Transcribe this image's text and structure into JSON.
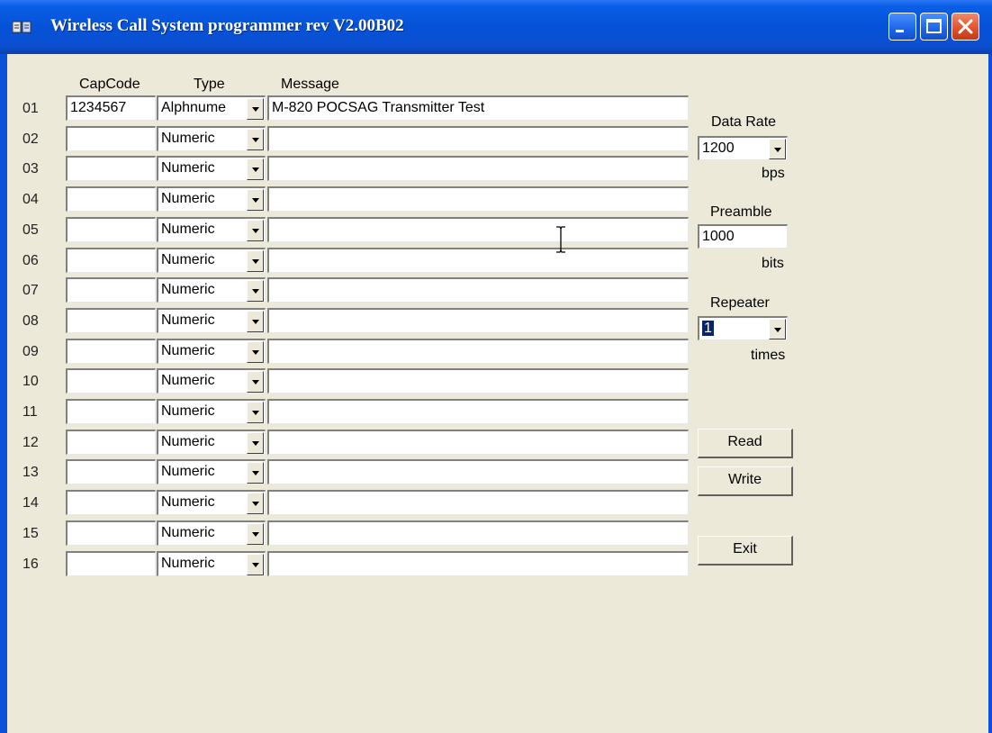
{
  "window": {
    "title": "Wireless Call System programmer rev  V2.00B02"
  },
  "headers": {
    "capcode": "CapCode",
    "type": "Type",
    "message": "Message"
  },
  "rows": [
    {
      "num": "01",
      "capcode": "1234567",
      "type": "Alphnume",
      "message": "M-820 POCSAG Transmitter Test"
    },
    {
      "num": "02",
      "capcode": "",
      "type": "Numeric",
      "message": ""
    },
    {
      "num": "03",
      "capcode": "",
      "type": "Numeric",
      "message": ""
    },
    {
      "num": "04",
      "capcode": "",
      "type": "Numeric",
      "message": ""
    },
    {
      "num": "05",
      "capcode": "",
      "type": "Numeric",
      "message": ""
    },
    {
      "num": "06",
      "capcode": "",
      "type": "Numeric",
      "message": ""
    },
    {
      "num": "07",
      "capcode": "",
      "type": "Numeric",
      "message": ""
    },
    {
      "num": "08",
      "capcode": "",
      "type": "Numeric",
      "message": ""
    },
    {
      "num": "09",
      "capcode": "",
      "type": "Numeric",
      "message": ""
    },
    {
      "num": "10",
      "capcode": "",
      "type": "Numeric",
      "message": ""
    },
    {
      "num": "11",
      "capcode": "",
      "type": "Numeric",
      "message": ""
    },
    {
      "num": "12",
      "capcode": "",
      "type": "Numeric",
      "message": ""
    },
    {
      "num": "13",
      "capcode": "",
      "type": "Numeric",
      "message": ""
    },
    {
      "num": "14",
      "capcode": "",
      "type": "Numeric",
      "message": ""
    },
    {
      "num": "15",
      "capcode": "",
      "type": "Numeric",
      "message": ""
    },
    {
      "num": "16",
      "capcode": "",
      "type": "Numeric",
      "message": ""
    }
  ],
  "data_rate": {
    "label": "Data Rate",
    "value": "1200",
    "unit": "bps"
  },
  "preamble": {
    "label": "Preamble",
    "value": "1000",
    "unit": "bits"
  },
  "repeater": {
    "label": "Repeater",
    "value": "1",
    "unit": "times"
  },
  "buttons": {
    "read": "Read",
    "write": "Write",
    "exit": "Exit"
  },
  "colors": {
    "titlebar": "#0552d8",
    "client": "#ece9d8",
    "close": "#e0502a",
    "selection": "#0a246a"
  },
  "icons": [
    "app-icon",
    "minimize-icon",
    "maximize-icon",
    "close-icon",
    "dropdown-arrow-icon"
  ]
}
